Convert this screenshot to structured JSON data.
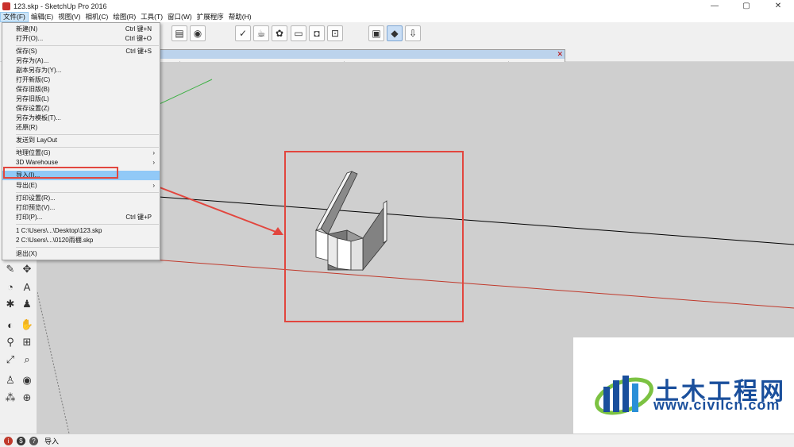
{
  "window": {
    "title": "123.skp - SketchUp Pro 2016",
    "minimize_glyph": "—",
    "maximize_glyph": "▢",
    "close_glyph": "✕"
  },
  "menubar": {
    "items": [
      "文件(F)",
      "编辑(E)",
      "视图(V)",
      "相机(C)",
      "绘图(R)",
      "工具(T)",
      "窗口(W)",
      "扩展程序",
      "帮助(H)"
    ]
  },
  "file_menu": {
    "items": [
      {
        "label": "新建(N)",
        "shortcut": "Ctrl 键+N"
      },
      {
        "label": "打开(O)...",
        "shortcut": "Ctrl 键+O"
      },
      {
        "label": "保存(S)",
        "shortcut": "Ctrl 键+S"
      },
      {
        "label": "另存为(A)...",
        "shortcut": ""
      },
      {
        "label": "副本另存为(Y)...",
        "shortcut": ""
      },
      {
        "label": "打开新版(C)",
        "shortcut": ""
      },
      {
        "label": "保存旧版(B)",
        "shortcut": ""
      },
      {
        "label": "另存旧版(L)",
        "shortcut": ""
      },
      {
        "label": "保存设置(Z)",
        "shortcut": ""
      },
      {
        "label": "另存为模板(T)...",
        "shortcut": ""
      },
      {
        "label": "还原(R)",
        "shortcut": ""
      },
      {
        "label": "发送到 LayOut",
        "shortcut": ""
      },
      {
        "label": "地理位置(G)",
        "shortcut": ""
      },
      {
        "label": "3D Warehouse",
        "shortcut": ""
      },
      {
        "label": "导入(I)...",
        "shortcut": ""
      },
      {
        "label": "导出(E)",
        "shortcut": ""
      },
      {
        "label": "打印设置(R)...",
        "shortcut": ""
      },
      {
        "label": "打印预览(V)...",
        "shortcut": ""
      },
      {
        "label": "打印(P)...",
        "shortcut": "Ctrl 键+P"
      },
      {
        "label": "1 C:\\Users\\...\\Desktop\\123.skp",
        "shortcut": ""
      },
      {
        "label": "2 C:\\Users\\...\\0120雨棚.skp",
        "shortcut": ""
      },
      {
        "label": "退出(X)",
        "shortcut": ""
      }
    ],
    "submenu_arrow": "›",
    "highlighted_index": 14
  },
  "statusbar": {
    "text": "导入",
    "icon1": "i",
    "icon2": "$",
    "icon3": "?"
  },
  "watermark": {
    "name": "土木工程网",
    "url": "www.civilcn.com"
  },
  "colors": {
    "accent": "#e2463e",
    "menu_highlight": "#91c9f7",
    "viewport_bg": "#cfcfcf",
    "watermark_blue": "#1a4f9c"
  }
}
